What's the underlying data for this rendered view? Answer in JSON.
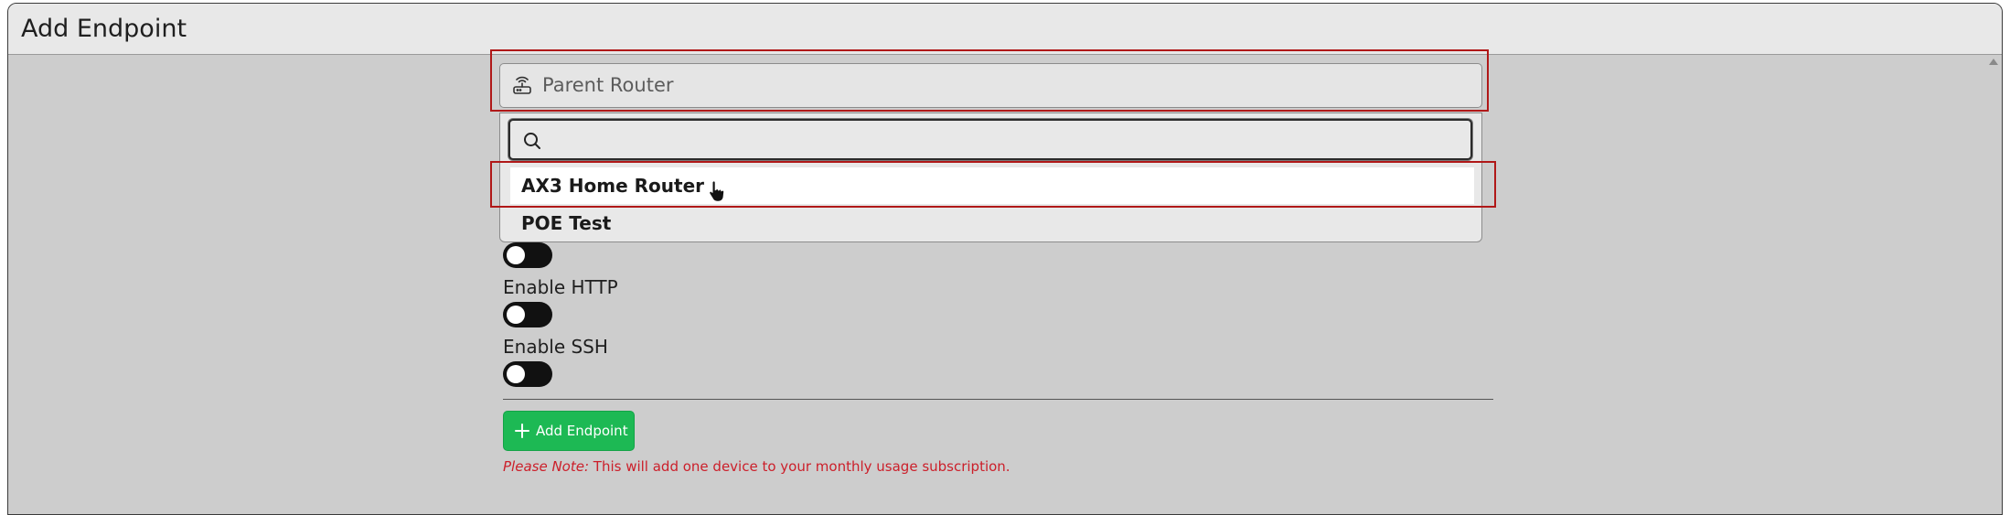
{
  "window": {
    "title": "Add Endpoint"
  },
  "parent_router": {
    "placeholder": "Parent Router",
    "search_value": "",
    "options": [
      {
        "label": "AX3 Home Router",
        "highlighted": true
      },
      {
        "label": "POE Test",
        "highlighted": false
      }
    ]
  },
  "toggles": [
    {
      "label": "Enable HTTP",
      "on": false
    },
    {
      "label": "Enable SSH",
      "on": false
    }
  ],
  "actions": {
    "add_endpoint_label": "Add Endpoint"
  },
  "note": {
    "prefix": "Please Note:",
    "text": " This will add one device to your monthly usage subscription."
  },
  "colors": {
    "accent_green": "#1db954",
    "highlight_red": "#b01818",
    "note_red": "#cc1f2a",
    "toggle_off": "#111111"
  }
}
